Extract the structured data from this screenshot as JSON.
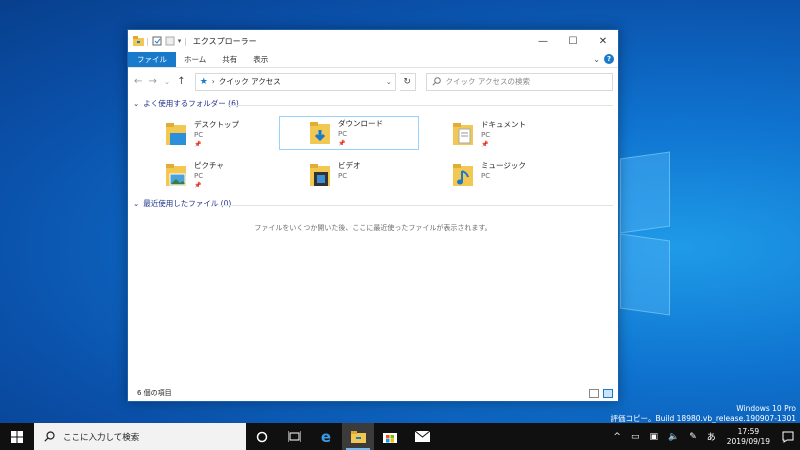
{
  "window": {
    "title": "エクスプローラー",
    "controls": [
      "minimize",
      "maximize",
      "close"
    ]
  },
  "ribbon": {
    "tabs": [
      "ファイル",
      "ホーム",
      "共有",
      "表示"
    ]
  },
  "navigation": {
    "address_path": "クイック アクセス",
    "search_placeholder": "クイック アクセスの検索"
  },
  "frequent_folders": {
    "header": "よく使用するフォルダー (6)",
    "items": [
      {
        "name": "デスクトップ",
        "location": "PC",
        "pinned": true,
        "icon": "desktop-folder-icon"
      },
      {
        "name": "ダウンロード",
        "location": "PC",
        "pinned": true,
        "icon": "downloads-folder-icon",
        "selected": true
      },
      {
        "name": "ドキュメント",
        "location": "PC",
        "pinned": true,
        "icon": "documents-folder-icon"
      },
      {
        "name": "ピクチャ",
        "location": "PC",
        "pinned": true,
        "icon": "pictures-folder-icon"
      },
      {
        "name": "ビデオ",
        "location": "PC",
        "pinned": false,
        "icon": "videos-folder-icon"
      },
      {
        "name": "ミュージック",
        "location": "PC",
        "pinned": false,
        "icon": "music-folder-icon"
      }
    ]
  },
  "recent_files": {
    "header": "最近使用したファイル (0)",
    "empty_message": "ファイルをいくつか開いた後、ここに最近使ったファイルが表示されます。"
  },
  "status": {
    "item_count": "6 個の項目"
  },
  "watermark": {
    "line1": "Windows 10 Pro",
    "line2": "評価コピー。Build 18980.vb_release.190907-1301"
  },
  "taskbar": {
    "search_placeholder": "ここに入力して検索",
    "ime": "あ",
    "time": "17:59",
    "date": "2019/09/19"
  },
  "colors": {
    "accent": "#1979ca",
    "desktop": "#0f74d0",
    "taskbar": "#101010",
    "folder": "#f3c852"
  }
}
